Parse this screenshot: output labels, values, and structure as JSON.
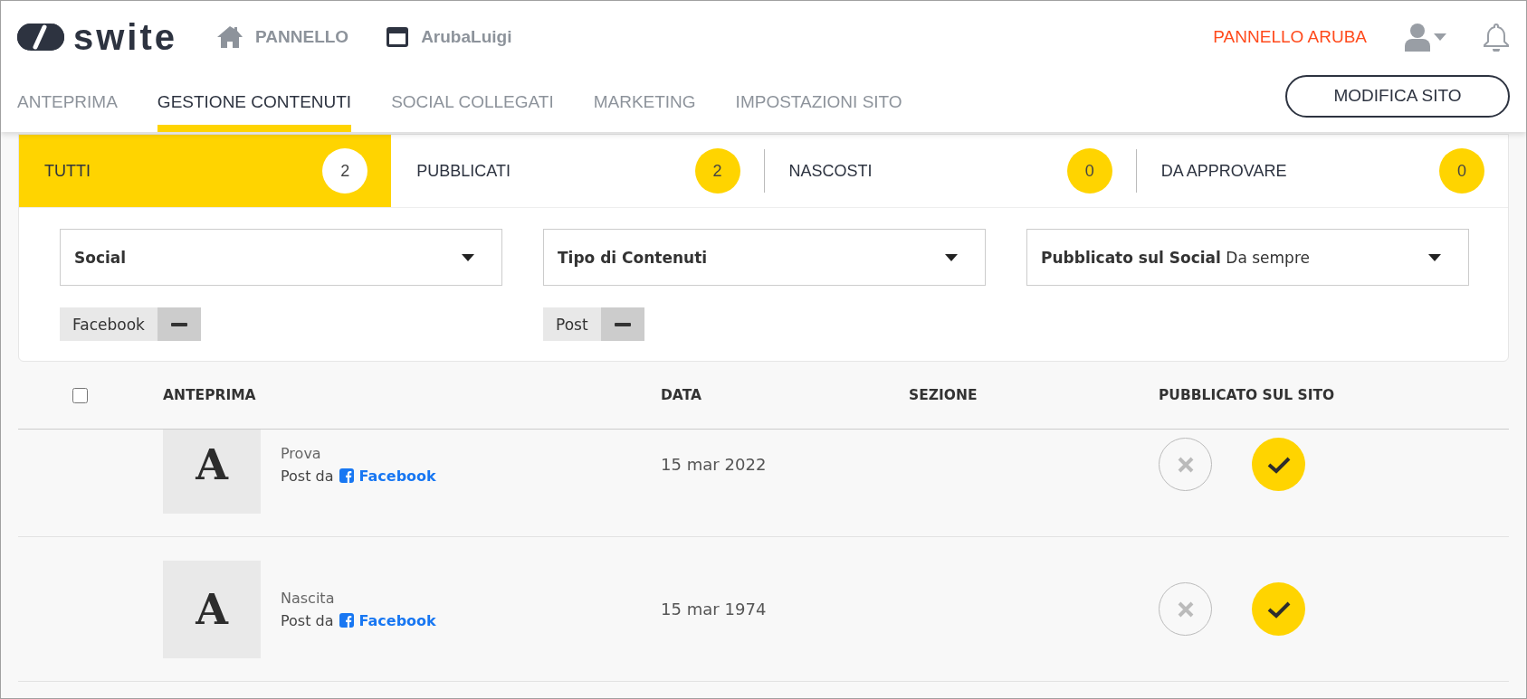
{
  "header": {
    "logo": "swite",
    "nav": [
      {
        "kind": "home",
        "label": "PANNELLO"
      },
      {
        "kind": "site",
        "label": "ArubaLuigi"
      }
    ],
    "panel_link": "PANNELLO ARUBA"
  },
  "tabs": [
    {
      "label": "ANTEPRIMA",
      "selected": false
    },
    {
      "label": "GESTIONE CONTENUTI",
      "selected": true
    },
    {
      "label": "SOCIAL COLLEGATI",
      "selected": false
    },
    {
      "label": "MARKETING",
      "selected": false
    },
    {
      "label": "IMPOSTAZIONI SITO",
      "selected": false
    }
  ],
  "edit_button": "MODIFICA SITO",
  "status_tabs": [
    {
      "label": "TUTTI",
      "count": "2",
      "selected": true
    },
    {
      "label": "PUBBLICATI",
      "count": "2",
      "selected": false
    },
    {
      "label": "NASCOSTI",
      "count": "0",
      "selected": false
    },
    {
      "label": "DA APPROVARE",
      "count": "0",
      "selected": false
    }
  ],
  "filters": [
    {
      "label": "Social",
      "chips": [
        "Facebook"
      ]
    },
    {
      "label": "Tipo di Contenuti",
      "chips": [
        "Post"
      ]
    },
    {
      "label": "Pubblicato sul Social",
      "value": "Da sempre"
    }
  ],
  "table": {
    "select_all": {
      "checked": false
    },
    "columns": [
      "ANTEPRIMA",
      "DATA",
      "SEZIONE",
      "PUBBLICATO SUL SITO"
    ],
    "rows": [
      {
        "thumb": "A",
        "title": "Prova",
        "source_prefix": "Post da",
        "source": "Facebook",
        "date": "15 mar",
        "year": "2022",
        "published": true
      },
      {
        "thumb": "A",
        "title": "Nascita",
        "source_prefix": "Post da",
        "source": "Facebook",
        "date": "15 mar",
        "year": "1974",
        "published": true
      }
    ]
  }
}
